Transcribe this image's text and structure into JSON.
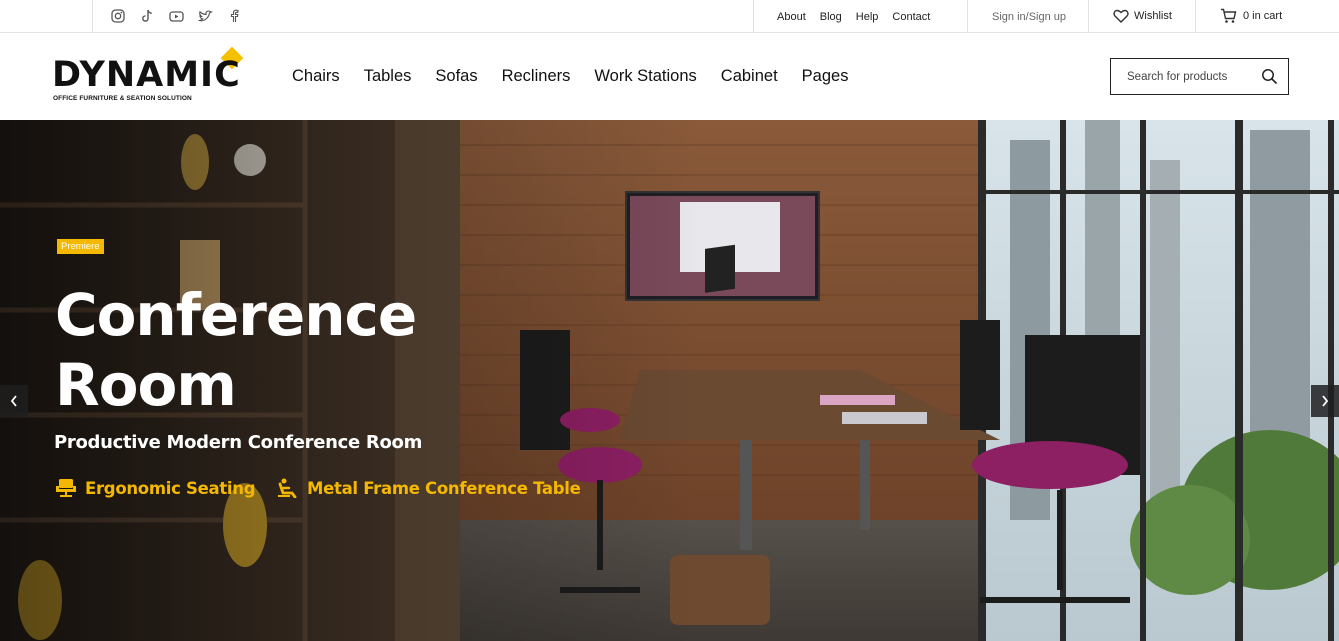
{
  "topbar": {
    "social_icons": [
      "instagram-icon",
      "tiktok-icon",
      "youtube-icon",
      "twitter-icon",
      "facebook-icon"
    ],
    "links": [
      "About",
      "Blog",
      "Help",
      "Contact"
    ],
    "signin": "Sign in/Sign up",
    "wishlist": "Wishlist",
    "cart": "0 in cart"
  },
  "header": {
    "logo_word": "DYNAMIC",
    "logo_tagline": "OFFICE FURNITURE & SEATION SOLUTION",
    "nav": [
      "Chairs",
      "Tables",
      "Sofas",
      "Recliners",
      "Work Stations",
      "Cabinet",
      "Pages"
    ],
    "search_placeholder": "Search for products"
  },
  "hero": {
    "badge": "Premiere",
    "title": "Conference Room",
    "subtitle": "Productive Modern Conference Room",
    "features": [
      {
        "icon": "chair-icon",
        "label": "Ergonomic Seating"
      },
      {
        "icon": "recliner-icon",
        "label": "Metal Frame Conference Table"
      }
    ],
    "prev_icon": "chevron-left-icon",
    "next_icon": "chevron-right-icon"
  },
  "colors": {
    "accent": "#f5b800",
    "logo_diamond": "#f5c000"
  }
}
